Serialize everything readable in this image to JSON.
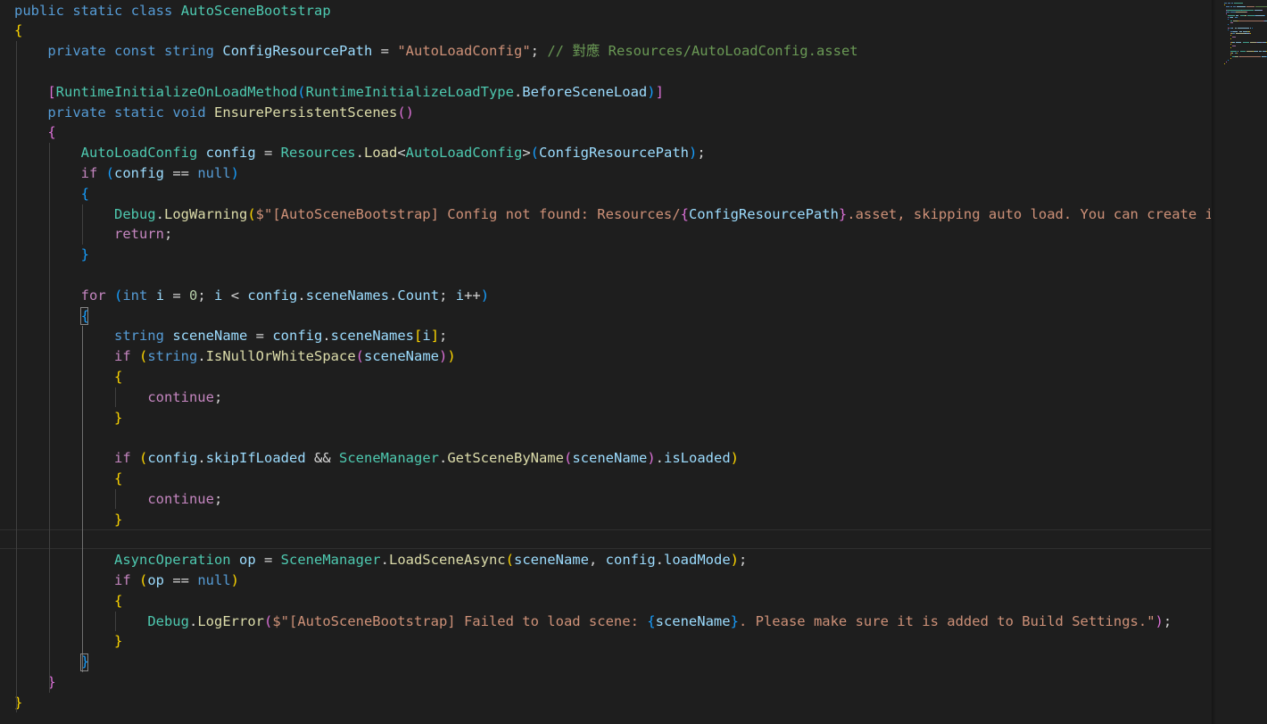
{
  "editor": {
    "language": "csharp",
    "theme_colors": {
      "background": "#1e1e1e",
      "keyword_blue": "#569cd6",
      "control_purple": "#c586c0",
      "type_teal": "#4ec9b0",
      "method_yellow": "#dcdcaa",
      "variable_blue": "#9cdcfe",
      "string_orange": "#ce9178",
      "comment_green": "#6a9955",
      "number_green": "#b5cea8",
      "brace_gold": "#ffd700",
      "brace_purple": "#da70d6",
      "brace_blue": "#179fff",
      "plain": "#d4d4d4"
    },
    "lines": [
      [
        [
          "public",
          "kw"
        ],
        [
          " ",
          "p"
        ],
        [
          "static",
          "kw"
        ],
        [
          " ",
          "p"
        ],
        [
          "class",
          "kw"
        ],
        [
          " ",
          "p"
        ],
        [
          "AutoSceneBootstrap",
          "ty"
        ]
      ],
      [
        [
          "{",
          "b1"
        ]
      ],
      [
        [
          "    ",
          "p"
        ],
        [
          "private",
          "kw"
        ],
        [
          " ",
          "p"
        ],
        [
          "const",
          "kw"
        ],
        [
          " ",
          "p"
        ],
        [
          "string",
          "kw"
        ],
        [
          " ",
          "p"
        ],
        [
          "ConfigResourcePath",
          "va"
        ],
        [
          " = ",
          "p"
        ],
        [
          "\"AutoLoadConfig\"",
          "st"
        ],
        [
          "; ",
          "p"
        ],
        [
          "// 對應 Resources/AutoLoadConfig.asset",
          "cm"
        ]
      ],
      [
        [
          "",
          "p"
        ]
      ],
      [
        [
          "    ",
          "p"
        ],
        [
          "[",
          "b2"
        ],
        [
          "RuntimeInitializeOnLoadMethod",
          "ty"
        ],
        [
          "(",
          "b3"
        ],
        [
          "RuntimeInitializeLoadType",
          "ty"
        ],
        [
          ".",
          "p"
        ],
        [
          "BeforeSceneLoad",
          "va"
        ],
        [
          ")",
          "b3"
        ],
        [
          "]",
          "b2"
        ]
      ],
      [
        [
          "    ",
          "p"
        ],
        [
          "private",
          "kw"
        ],
        [
          " ",
          "p"
        ],
        [
          "static",
          "kw"
        ],
        [
          " ",
          "p"
        ],
        [
          "void",
          "kw"
        ],
        [
          " ",
          "p"
        ],
        [
          "EnsurePersistentScenes",
          "me"
        ],
        [
          "()",
          "b2"
        ]
      ],
      [
        [
          "    ",
          "p"
        ],
        [
          "{",
          "b2"
        ]
      ],
      [
        [
          "        ",
          "p"
        ],
        [
          "AutoLoadConfig",
          "ty"
        ],
        [
          " ",
          "p"
        ],
        [
          "config",
          "va"
        ],
        [
          " = ",
          "p"
        ],
        [
          "Resources",
          "ty"
        ],
        [
          ".",
          "p"
        ],
        [
          "Load",
          "me"
        ],
        [
          "<",
          "p"
        ],
        [
          "AutoLoadConfig",
          "ty"
        ],
        [
          ">",
          "p"
        ],
        [
          "(",
          "b3"
        ],
        [
          "ConfigResourcePath",
          "va"
        ],
        [
          ")",
          "b3"
        ],
        [
          ";",
          "p"
        ]
      ],
      [
        [
          "        ",
          "p"
        ],
        [
          "if",
          "ct"
        ],
        [
          " ",
          "p"
        ],
        [
          "(",
          "b3"
        ],
        [
          "config",
          "va"
        ],
        [
          " == ",
          "p"
        ],
        [
          "null",
          "kw"
        ],
        [
          ")",
          "b3"
        ]
      ],
      [
        [
          "        ",
          "p"
        ],
        [
          "{",
          "b3"
        ]
      ],
      [
        [
          "            ",
          "p"
        ],
        [
          "Debug",
          "ty"
        ],
        [
          ".",
          "p"
        ],
        [
          "LogWarning",
          "me"
        ],
        [
          "(",
          "b1"
        ],
        [
          "$\"[AutoSceneBootstrap] Config not found: Resources/",
          "st"
        ],
        [
          "{",
          "b2"
        ],
        [
          "ConfigResourcePath",
          "va"
        ],
        [
          "}",
          "b2"
        ],
        [
          ".asset, skipping auto load. You can create it",
          "st"
        ]
      ],
      [
        [
          "            ",
          "p"
        ],
        [
          "return",
          "ct"
        ],
        [
          ";",
          "p"
        ]
      ],
      [
        [
          "        ",
          "p"
        ],
        [
          "}",
          "b3"
        ]
      ],
      [
        [
          "",
          "p"
        ]
      ],
      [
        [
          "        ",
          "p"
        ],
        [
          "for",
          "ct"
        ],
        [
          " ",
          "p"
        ],
        [
          "(",
          "b3"
        ],
        [
          "int",
          "kw"
        ],
        [
          " ",
          "p"
        ],
        [
          "i",
          "va"
        ],
        [
          " = ",
          "p"
        ],
        [
          "0",
          "nu"
        ],
        [
          "; ",
          "p"
        ],
        [
          "i",
          "va"
        ],
        [
          " < ",
          "p"
        ],
        [
          "config",
          "va"
        ],
        [
          ".",
          "p"
        ],
        [
          "sceneNames",
          "va"
        ],
        [
          ".",
          "p"
        ],
        [
          "Count",
          "va"
        ],
        [
          "; ",
          "p"
        ],
        [
          "i",
          "va"
        ],
        [
          "++",
          "p"
        ],
        [
          ")",
          "b3"
        ]
      ],
      [
        [
          "        ",
          "p"
        ],
        [
          "{",
          "b3"
        ]
      ],
      [
        [
          "            ",
          "p"
        ],
        [
          "string",
          "kw"
        ],
        [
          " ",
          "p"
        ],
        [
          "sceneName",
          "va"
        ],
        [
          " = ",
          "p"
        ],
        [
          "config",
          "va"
        ],
        [
          ".",
          "p"
        ],
        [
          "sceneNames",
          "va"
        ],
        [
          "[",
          "b1"
        ],
        [
          "i",
          "va"
        ],
        [
          "]",
          "b1"
        ],
        [
          ";",
          "p"
        ]
      ],
      [
        [
          "            ",
          "p"
        ],
        [
          "if",
          "ct"
        ],
        [
          " ",
          "p"
        ],
        [
          "(",
          "b1"
        ],
        [
          "string",
          "kw"
        ],
        [
          ".",
          "p"
        ],
        [
          "IsNullOrWhiteSpace",
          "me"
        ],
        [
          "(",
          "b2"
        ],
        [
          "sceneName",
          "va"
        ],
        [
          ")",
          "b2"
        ],
        [
          ")",
          "b1"
        ]
      ],
      [
        [
          "            ",
          "p"
        ],
        [
          "{",
          "b1"
        ]
      ],
      [
        [
          "                ",
          "p"
        ],
        [
          "continue",
          "ct"
        ],
        [
          ";",
          "p"
        ]
      ],
      [
        [
          "            ",
          "p"
        ],
        [
          "}",
          "b1"
        ]
      ],
      [
        [
          "",
          "p"
        ]
      ],
      [
        [
          "            ",
          "p"
        ],
        [
          "if",
          "ct"
        ],
        [
          " ",
          "p"
        ],
        [
          "(",
          "b1"
        ],
        [
          "config",
          "va"
        ],
        [
          ".",
          "p"
        ],
        [
          "skipIfLoaded",
          "va"
        ],
        [
          " && ",
          "p"
        ],
        [
          "SceneManager",
          "ty"
        ],
        [
          ".",
          "p"
        ],
        [
          "GetSceneByName",
          "me"
        ],
        [
          "(",
          "b2"
        ],
        [
          "sceneName",
          "va"
        ],
        [
          ")",
          "b2"
        ],
        [
          ".",
          "p"
        ],
        [
          "isLoaded",
          "va"
        ],
        [
          ")",
          "b1"
        ]
      ],
      [
        [
          "            ",
          "p"
        ],
        [
          "{",
          "b1"
        ]
      ],
      [
        [
          "                ",
          "p"
        ],
        [
          "continue",
          "ct"
        ],
        [
          ";",
          "p"
        ]
      ],
      [
        [
          "            ",
          "p"
        ],
        [
          "}",
          "b1"
        ]
      ],
      [
        [
          "",
          "p"
        ]
      ],
      [
        [
          "            ",
          "p"
        ],
        [
          "AsyncOperation",
          "ty"
        ],
        [
          " ",
          "p"
        ],
        [
          "op",
          "va"
        ],
        [
          " = ",
          "p"
        ],
        [
          "SceneManager",
          "ty"
        ],
        [
          ".",
          "p"
        ],
        [
          "LoadSceneAsync",
          "me"
        ],
        [
          "(",
          "b1"
        ],
        [
          "sceneName",
          "va"
        ],
        [
          ", ",
          "p"
        ],
        [
          "config",
          "va"
        ],
        [
          ".",
          "p"
        ],
        [
          "loadMode",
          "va"
        ],
        [
          ")",
          "b1"
        ],
        [
          ";",
          "p"
        ]
      ],
      [
        [
          "            ",
          "p"
        ],
        [
          "if",
          "ct"
        ],
        [
          " ",
          "p"
        ],
        [
          "(",
          "b1"
        ],
        [
          "op",
          "va"
        ],
        [
          " == ",
          "p"
        ],
        [
          "null",
          "kw"
        ],
        [
          ")",
          "b1"
        ]
      ],
      [
        [
          "            ",
          "p"
        ],
        [
          "{",
          "b1"
        ]
      ],
      [
        [
          "                ",
          "p"
        ],
        [
          "Debug",
          "ty"
        ],
        [
          ".",
          "p"
        ],
        [
          "LogError",
          "me"
        ],
        [
          "(",
          "b2"
        ],
        [
          "$\"[AutoSceneBootstrap] Failed to load scene: ",
          "st"
        ],
        [
          "{",
          "b3"
        ],
        [
          "sceneName",
          "va"
        ],
        [
          "}",
          "b3"
        ],
        [
          ". Please make sure it is added to Build Settings.\"",
          "st"
        ],
        [
          ")",
          "b2"
        ],
        [
          ";",
          "p"
        ]
      ],
      [
        [
          "            ",
          "p"
        ],
        [
          "}",
          "b1"
        ]
      ],
      [
        [
          "        ",
          "p"
        ],
        [
          "}",
          "b3"
        ]
      ],
      [
        [
          "    ",
          "p"
        ],
        [
          "}",
          "b2"
        ]
      ],
      [
        [
          "}",
          "b1"
        ]
      ]
    ]
  }
}
